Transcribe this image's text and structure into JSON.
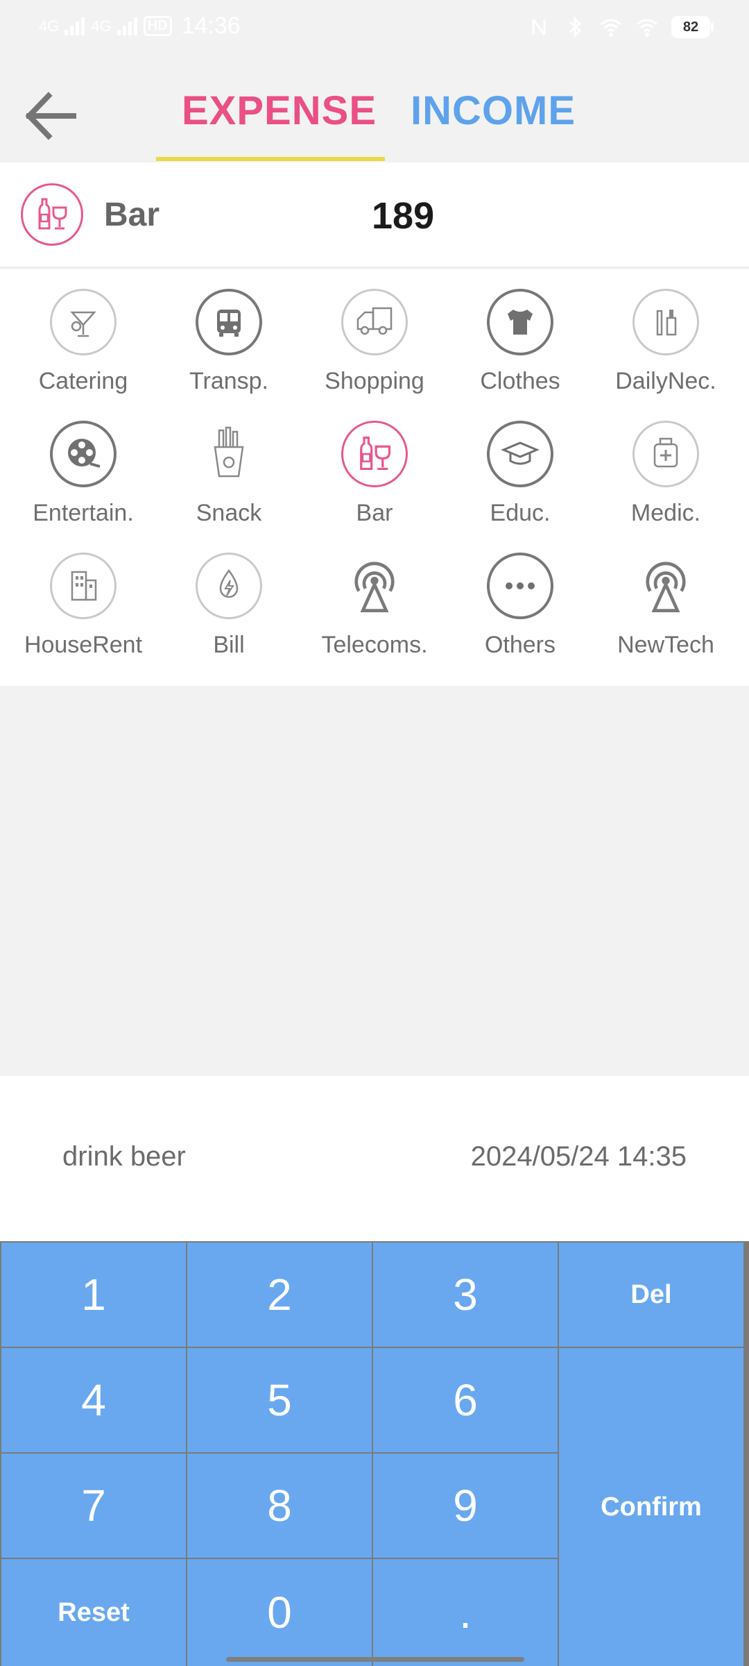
{
  "status_bar": {
    "signal1": "4G",
    "signal2": "4G",
    "hd": "HD",
    "time": "14:36",
    "battery": "82"
  },
  "header": {
    "tabs": [
      {
        "label": "EXPENSE",
        "active": true
      },
      {
        "label": "INCOME",
        "active": false
      }
    ],
    "active_color": "#ea4f86",
    "inactive_color": "#5ea2ec",
    "underline_color": "#e9d94a"
  },
  "selected": {
    "category": "Bar",
    "amount": "189",
    "icon": "wine-bottle-glass-icon"
  },
  "categories": [
    {
      "label": "Catering",
      "icon": "cocktail-icon"
    },
    {
      "label": "Transp.",
      "icon": "bus-icon"
    },
    {
      "label": "Shopping",
      "icon": "delivery-truck-icon"
    },
    {
      "label": "Clothes",
      "icon": "tshirt-icon"
    },
    {
      "label": "DailyNec.",
      "icon": "toiletries-icon"
    },
    {
      "label": "Entertain.",
      "icon": "film-reel-icon"
    },
    {
      "label": "Snack",
      "icon": "fries-icon"
    },
    {
      "label": "Bar",
      "icon": "wine-bottle-glass-icon"
    },
    {
      "label": "Educ.",
      "icon": "graduation-cap-icon"
    },
    {
      "label": "Medic.",
      "icon": "medicine-bottle-icon"
    },
    {
      "label": "HouseRent",
      "icon": "building-icon"
    },
    {
      "label": "Bill",
      "icon": "lightning-bill-icon"
    },
    {
      "label": "Telecoms.",
      "icon": "antenna-icon"
    },
    {
      "label": "Others",
      "icon": "more-dots-icon"
    },
    {
      "label": "NewTech",
      "icon": "antenna-icon"
    }
  ],
  "note": {
    "text": "drink beer",
    "datetime": "2024/05/24 14:35"
  },
  "keypad": {
    "k1": "1",
    "k2": "2",
    "k3": "3",
    "del": "Del",
    "k4": "4",
    "k5": "5",
    "k6": "6",
    "k7": "7",
    "k8": "8",
    "k9": "9",
    "confirm": "Confirm",
    "reset": "Reset",
    "k0": "0",
    "dot": ".",
    "key_color": "#69a8ef"
  }
}
